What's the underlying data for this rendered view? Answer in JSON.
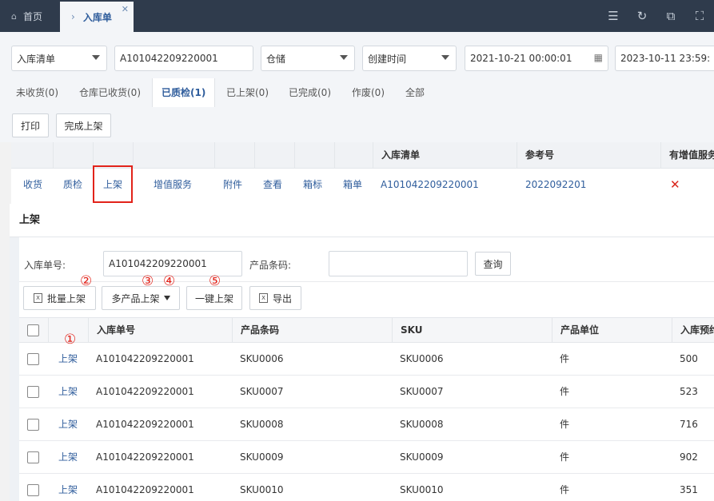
{
  "topbar": {
    "home_label": "首页",
    "active_tab": "入库单",
    "home_icon": "home-icon",
    "icons": [
      "list-icon",
      "refresh-icon",
      "external-link-icon",
      "fullscreen-icon"
    ]
  },
  "filters": {
    "type_select": "入库清单",
    "order_input": "A101042209220001",
    "warehouse_select": "仓储",
    "time_select": "创建时间",
    "start_time": "2021-10-21 00:00:01",
    "end_time": "2023-10-11 23:59:"
  },
  "status_tabs": [
    "未收货(0)",
    "仓库已收货(0)",
    "已质检(1)",
    "已上架(0)",
    "已完成(0)",
    "作废(0)",
    "全部"
  ],
  "actions": {
    "print": "打印",
    "complete_shelf": "完成上架"
  },
  "bg_table": {
    "headers": [
      "入库清单",
      "参考号",
      "有增值服务"
    ],
    "row_links": [
      "收货",
      "质检",
      "上架",
      "增值服务",
      "附件",
      "查看",
      "箱标",
      "箱单"
    ],
    "order_no": "A101042209220001",
    "ref_no": "2022092201",
    "has_vas_mark": "✕"
  },
  "modal": {
    "title": "上架",
    "order_label": "入库单号:",
    "order_value": "A101042209220001",
    "barcode_label": "产品条码:",
    "barcode_value": "",
    "query_button": "查询",
    "batch_shelf": "批量上架",
    "multi_shelf": "多产品上架",
    "one_click_shelf": "一键上架",
    "export": "导出",
    "markers": [
      "①",
      "②",
      "③",
      "④",
      "⑤"
    ],
    "columns": [
      "入库单号",
      "产品条码",
      "SKU",
      "产品单位",
      "入库预约"
    ],
    "row_action": "上架",
    "rows": [
      {
        "order": "A101042209220001",
        "barcode": "SKU0006",
        "sku": "SKU0006",
        "unit": "件",
        "qty": "500"
      },
      {
        "order": "A101042209220001",
        "barcode": "SKU0007",
        "sku": "SKU0007",
        "unit": "件",
        "qty": "523"
      },
      {
        "order": "A101042209220001",
        "barcode": "SKU0008",
        "sku": "SKU0008",
        "unit": "件",
        "qty": "716"
      },
      {
        "order": "A101042209220001",
        "barcode": "SKU0009",
        "sku": "SKU0009",
        "unit": "件",
        "qty": "902"
      },
      {
        "order": "A101042209220001",
        "barcode": "SKU0010",
        "sku": "SKU0010",
        "unit": "件",
        "qty": "351"
      }
    ]
  },
  "colors": {
    "link": "#2f5d9c",
    "accent_red": "#e2231a",
    "topbar": "#2f3b4c"
  }
}
